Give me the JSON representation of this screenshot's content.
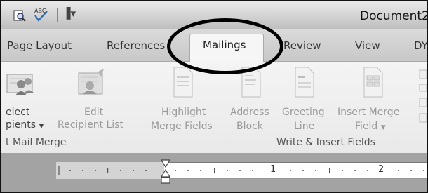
{
  "window": {
    "document_title": "Document2",
    "quick_access": {
      "more_glyph": "▐▾"
    }
  },
  "tabs": [
    {
      "label": "Page Layout"
    },
    {
      "label": "References"
    },
    {
      "label": "Mailings",
      "active": true
    },
    {
      "label": "Review"
    },
    {
      "label": "View"
    },
    {
      "label": "DY"
    }
  ],
  "ribbon": {
    "start_mail_merge_group": {
      "footer": "t Mail Merge",
      "select_recipients": {
        "line1": "elect",
        "line2": "pients"
      },
      "edit_recipient_list": {
        "line1": "Edit",
        "line2": "Recipient List"
      }
    },
    "write_insert_group": {
      "footer": "Write & Insert Fields",
      "highlight_merge_fields": {
        "line1": "Highlight",
        "line2": "Merge Fields"
      },
      "address_block": {
        "line1": "Address",
        "line2": "Block"
      },
      "greeting_line": {
        "line1": "Greeting",
        "line2": "Line"
      },
      "insert_merge_field": {
        "line1": "Insert Merge",
        "line2": "Field"
      }
    }
  },
  "ruler": {
    "numbers": [
      "1",
      "2"
    ]
  },
  "colors": {
    "annotation_ellipse": "#000000",
    "disabled_text": "#9a9a9a",
    "ruler_dark": "#a3a3a3"
  }
}
